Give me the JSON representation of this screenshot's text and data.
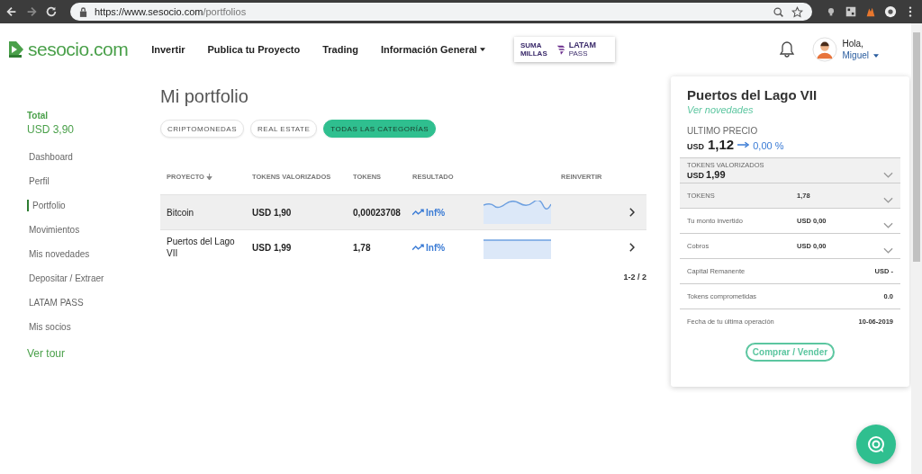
{
  "browser": {
    "url_host": "https://www.sesocio.com",
    "url_path": "/portfolios"
  },
  "header": {
    "logo": "sesocio.com",
    "nav": [
      {
        "label": "Invertir",
        "dropdown": false
      },
      {
        "label": "Publica tu Proyecto",
        "dropdown": false
      },
      {
        "label": "Trading",
        "dropdown": false
      },
      {
        "label": "Información General",
        "dropdown": true
      }
    ],
    "promo": {
      "line1": "SUMA",
      "line2": "MILLAS",
      "brand": "LATAM",
      "brand_sub": "PASS"
    },
    "user": {
      "greeting": "Hola,",
      "name": "Miguel"
    }
  },
  "sidebar": {
    "total_label": "Total",
    "total_value": "USD 3,90",
    "items": [
      {
        "label": "Dashboard",
        "selected": false
      },
      {
        "label": "Perfil",
        "selected": false
      },
      {
        "label": "Portfolio",
        "selected": true
      },
      {
        "label": "Movimientos",
        "selected": false
      },
      {
        "label": "Mis novedades",
        "selected": false
      },
      {
        "label": "Depositar / Extraer",
        "selected": false
      },
      {
        "label": "LATAM PASS",
        "selected": false
      },
      {
        "label": "Mis socios",
        "selected": false
      }
    ],
    "tour": "Ver tour"
  },
  "main": {
    "title": "Mi portfolio",
    "filters": [
      {
        "label": "CRIPTOMONEDAS",
        "selected": false
      },
      {
        "label": "REAL ESTATE",
        "selected": false
      },
      {
        "label": "TODAS LAS CATEGORÍAS",
        "selected": true
      }
    ],
    "columns": [
      {
        "label": "PROYECTO",
        "sortable": true
      },
      {
        "label": "TOKENS VALORIZADOS",
        "sortable": false
      },
      {
        "label": "TOKENS",
        "sortable": false
      },
      {
        "label": "RESULTADO",
        "sortable": false
      },
      {
        "label": "REINVERTIR",
        "sortable": false
      }
    ],
    "rows": [
      {
        "project": "Bitcoin",
        "valued": "USD 1,90",
        "tokens": "0,00023708",
        "result": "Inf%",
        "highlighted": true
      },
      {
        "project": "Puertos del Lago VII",
        "valued": "USD 1,99",
        "tokens": "1,78",
        "result": "Inf%",
        "highlighted": false
      }
    ],
    "pagination": "1-2 / 2"
  },
  "panel": {
    "title": "Puertos del Lago VII",
    "link": "Ver novedades",
    "price_label": "ULTIMO PRECIO",
    "price_currency": "USD",
    "price_value": "1,12",
    "price_change": "0,00 %",
    "sections": [
      {
        "kind": "big",
        "label": "TOKENS VALORIZADOS",
        "currency": "USD",
        "value": "1,99",
        "expandable": true,
        "shaded": true
      },
      {
        "kind": "row",
        "label": "TOKENS",
        "value": "1,78",
        "expandable": true,
        "shaded": true
      },
      {
        "kind": "row",
        "label": "Tu monto invertido",
        "value": "USD 0,00",
        "expandable": true,
        "shaded": false
      },
      {
        "kind": "row",
        "label": "Cobros",
        "value": "USD 0,00",
        "expandable": true,
        "shaded": false
      },
      {
        "kind": "row",
        "label": "Capital Remanente",
        "value": "USD -",
        "expandable": false,
        "shaded": false
      },
      {
        "kind": "row",
        "label": "Tokens comprometidas",
        "value": "0.0",
        "expandable": false,
        "shaded": false
      },
      {
        "kind": "row",
        "label": "Fecha de tu última operación",
        "value": "10-06-2019",
        "expandable": false,
        "shaded": false
      }
    ],
    "button": "Comprar / Vender"
  }
}
